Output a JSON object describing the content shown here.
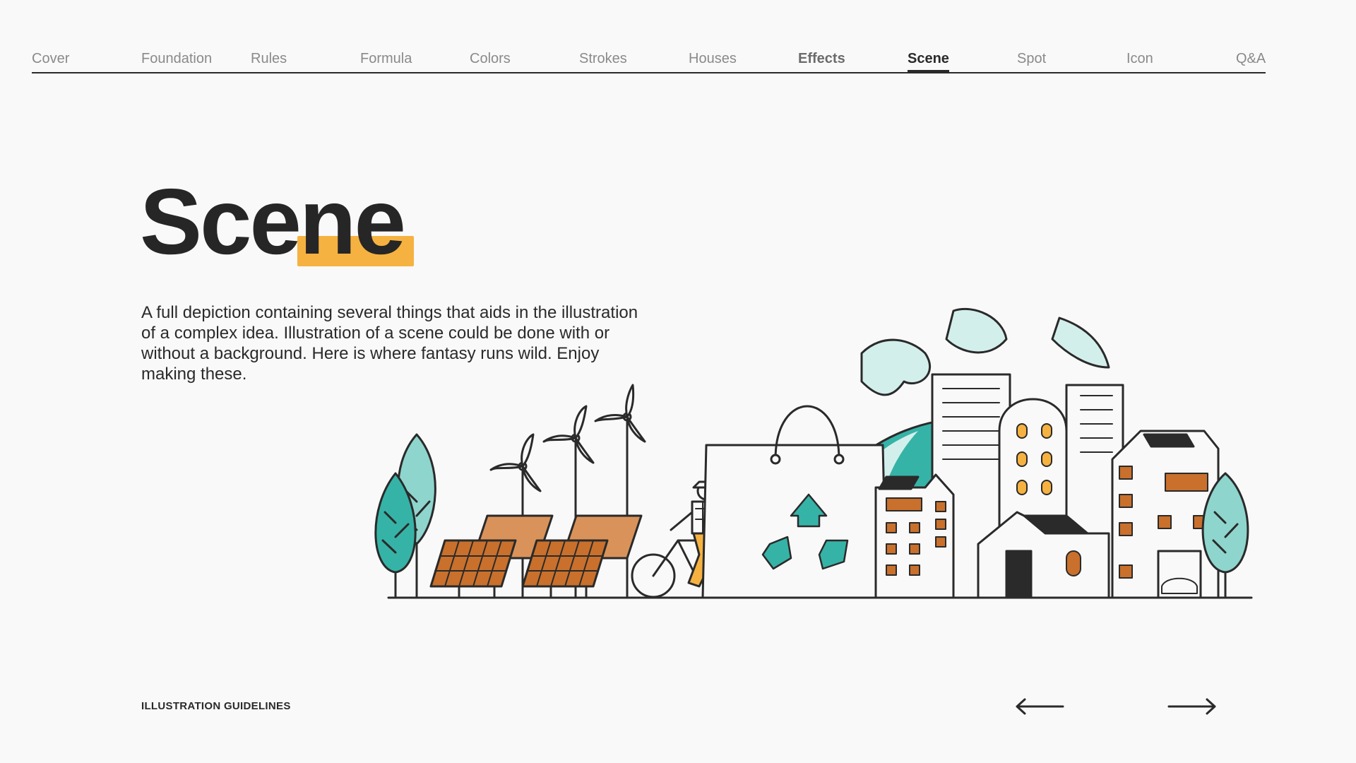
{
  "nav": {
    "items": [
      "Cover",
      "Foundation",
      "Rules",
      "Formula",
      "Colors",
      "Strokes",
      "Houses",
      "Effects",
      "Scene",
      "Spot",
      "Icon",
      "Q&A"
    ],
    "active": "Scene"
  },
  "page": {
    "title": "Scene",
    "description": "A full depiction containing several things that aids in the illustration of a complex idea. Illustration of a scene could be done with or without a background. Here is where fantasy runs wild. Enjoy making these."
  },
  "footer": {
    "label": "ILLUSTRATION GUIDELINES"
  },
  "colors": {
    "background": "#f9f9f9",
    "ink": "#2a2a2a",
    "accent_yellow": "#f6b240",
    "teal": "#36b3a7",
    "teal_light": "#8ed5cd",
    "teal_pale": "#d3efec",
    "panel_orange": "#c9702c",
    "panel_tan": "#d9935a"
  },
  "icons": {
    "prev": "arrow-left-icon",
    "next": "arrow-right-icon"
  }
}
